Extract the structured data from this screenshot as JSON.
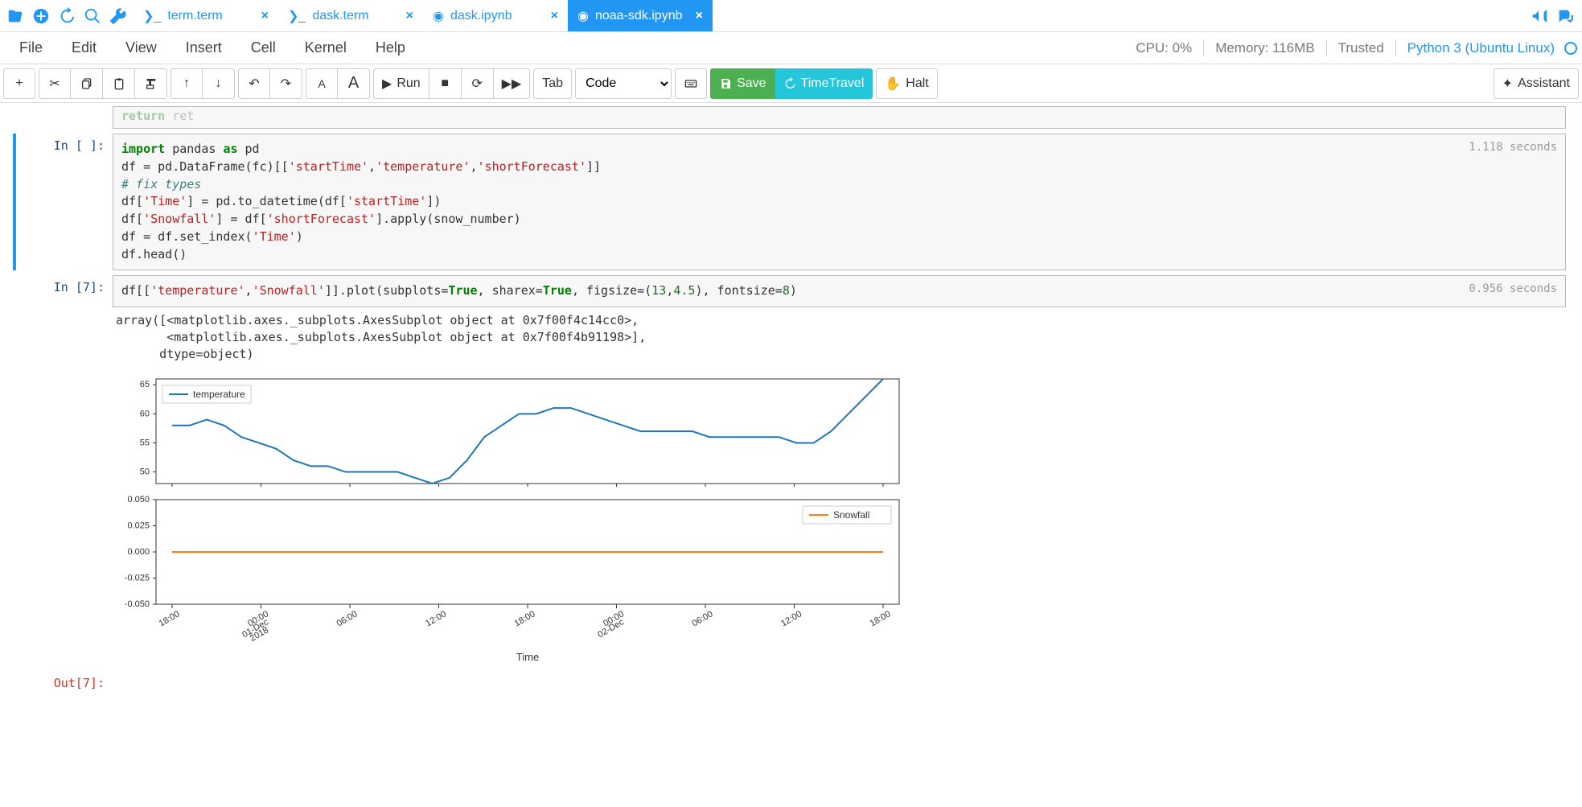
{
  "tabs": [
    {
      "label": "term.term"
    },
    {
      "label": "dask.term"
    },
    {
      "label": "dask.ipynb"
    },
    {
      "label": "noaa-sdk.ipynb"
    }
  ],
  "menu": {
    "file": "File",
    "edit": "Edit",
    "view": "View",
    "insert": "Insert",
    "cell": "Cell",
    "kernel": "Kernel",
    "help": "Help"
  },
  "status": {
    "cpu": "CPU: 0%",
    "memory": "Memory: 116MB",
    "trusted": "Trusted",
    "kernel": "Python 3 (Ubuntu Linux)"
  },
  "toolbar": {
    "run": "Run",
    "tab": "Tab",
    "cell_type": "Code",
    "save": "Save",
    "timetravel": "TimeTravel",
    "halt": "Halt",
    "assistant": "Assistant"
  },
  "truncated_line": "return ret",
  "cells": {
    "c1": {
      "prompt": "In [ ]:",
      "timing": "1.118 seconds"
    },
    "c2": {
      "prompt": "In [7]:",
      "timing": "0.956 seconds",
      "output": "array([<matplotlib.axes._subplots.AxesSubplot object at 0x7f00f4c14cc0>,\n       <matplotlib.axes._subplots.AxesSubplot object at 0x7f00f4b91198>],\n      dtype=object)"
    },
    "out_prompt": "Out[7]:"
  },
  "chart_data": [
    {
      "type": "line",
      "title": "",
      "legend": "temperature",
      "xlabel": "",
      "ylabel": "",
      "ylim": [
        48,
        66
      ],
      "yticks": [
        50,
        55,
        60,
        65
      ],
      "x": [
        "18:00",
        "00:00 01-Dec 2018",
        "06:00",
        "12:00",
        "18:00",
        "00:00 02-Dec",
        "06:00",
        "12:00",
        "18:00"
      ],
      "series": [
        {
          "name": "temperature",
          "values": [
            58,
            58,
            59,
            58,
            56,
            55,
            54,
            52,
            51,
            51,
            50,
            50,
            50,
            50,
            49,
            48,
            49,
            52,
            56,
            58,
            60,
            60,
            61,
            61,
            60,
            59,
            58,
            57,
            57,
            57,
            57,
            56,
            56,
            56,
            56,
            56,
            55,
            55,
            57,
            60,
            63,
            66
          ]
        }
      ]
    },
    {
      "type": "line",
      "title": "",
      "legend": "Snowfall",
      "xlabel": "Time",
      "ylabel": "",
      "ylim": [
        -0.05,
        0.05
      ],
      "yticks": [
        -0.05,
        -0.025,
        0.0,
        0.025,
        0.05
      ],
      "x_ticks": [
        "18:00",
        "00:00\n01-Dec\n2018",
        "06:00",
        "12:00",
        "18:00",
        "00:00\n02-Dec",
        "06:00",
        "12:00",
        "18:00"
      ],
      "series": [
        {
          "name": "Snowfall",
          "values": [
            0,
            0,
            0,
            0,
            0,
            0,
            0,
            0,
            0,
            0,
            0,
            0,
            0,
            0,
            0,
            0,
            0,
            0,
            0,
            0,
            0,
            0,
            0,
            0,
            0,
            0,
            0,
            0,
            0,
            0,
            0,
            0,
            0,
            0,
            0,
            0,
            0,
            0,
            0,
            0,
            0,
            0
          ]
        }
      ]
    }
  ]
}
